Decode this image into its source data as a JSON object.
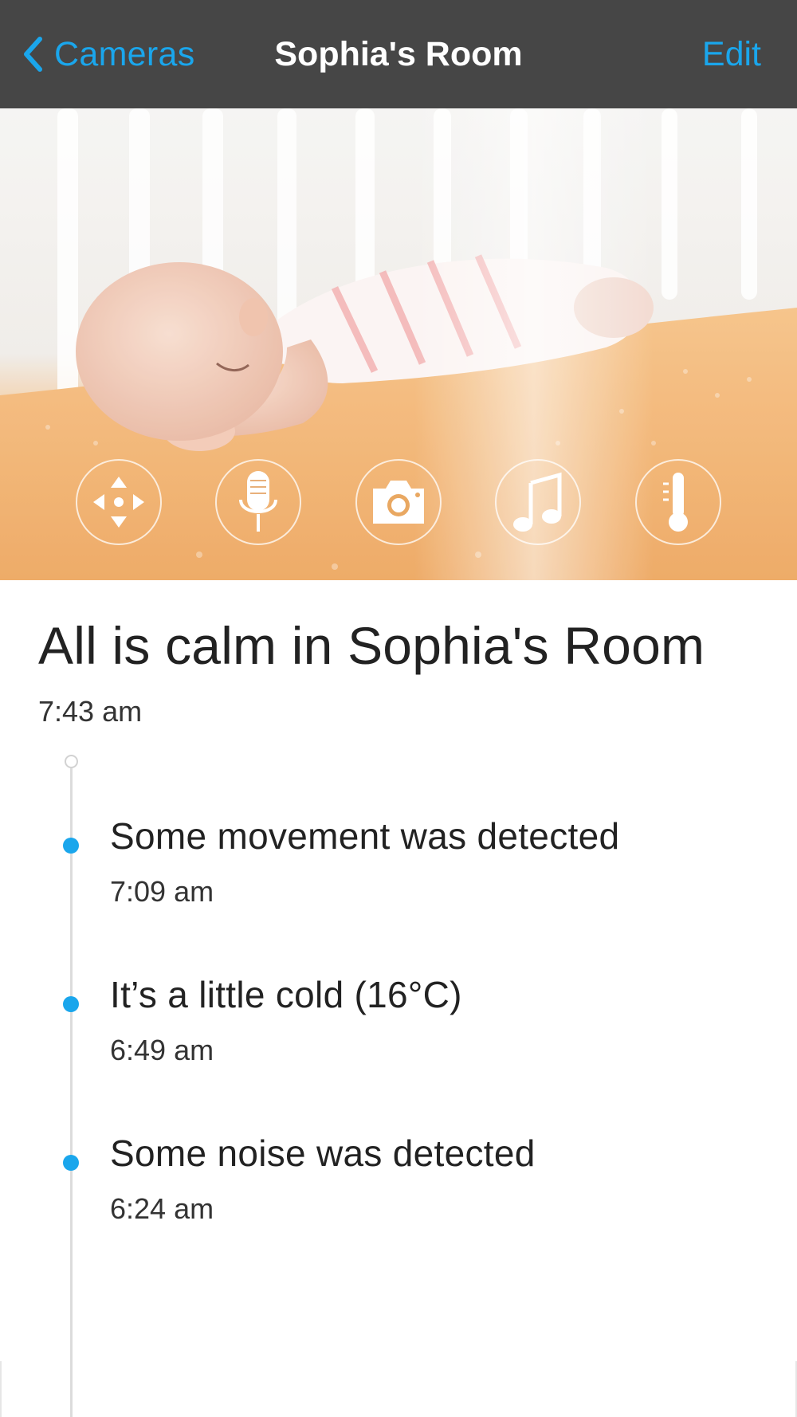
{
  "nav": {
    "back_label": "Cameras",
    "title": "Sophia's Room",
    "edit_label": "Edit"
  },
  "camera": {
    "controls": [
      {
        "name": "pan-tilt-button",
        "icon": "move-arrows-icon"
      },
      {
        "name": "talk-button",
        "icon": "microphone-icon"
      },
      {
        "name": "snapshot-button",
        "icon": "camera-icon"
      },
      {
        "name": "lullaby-button",
        "icon": "music-note-icon"
      },
      {
        "name": "temperature-button",
        "icon": "thermometer-icon"
      }
    ]
  },
  "status": {
    "heading": "All is calm in Sophia's Room",
    "time": "7:43 am"
  },
  "timeline": {
    "events": [
      {
        "title": "Some movement was detected",
        "time": "7:09 am"
      },
      {
        "title": "It’s a little cold (16°C)",
        "time": "6:49 am"
      },
      {
        "title": "Some noise was detected",
        "time": "6:24 am"
      }
    ]
  },
  "colors": {
    "accent": "#1aa6ec",
    "navbar_bg": "#464646",
    "text": "#222222",
    "timeline_line": "#dcdcdc"
  }
}
